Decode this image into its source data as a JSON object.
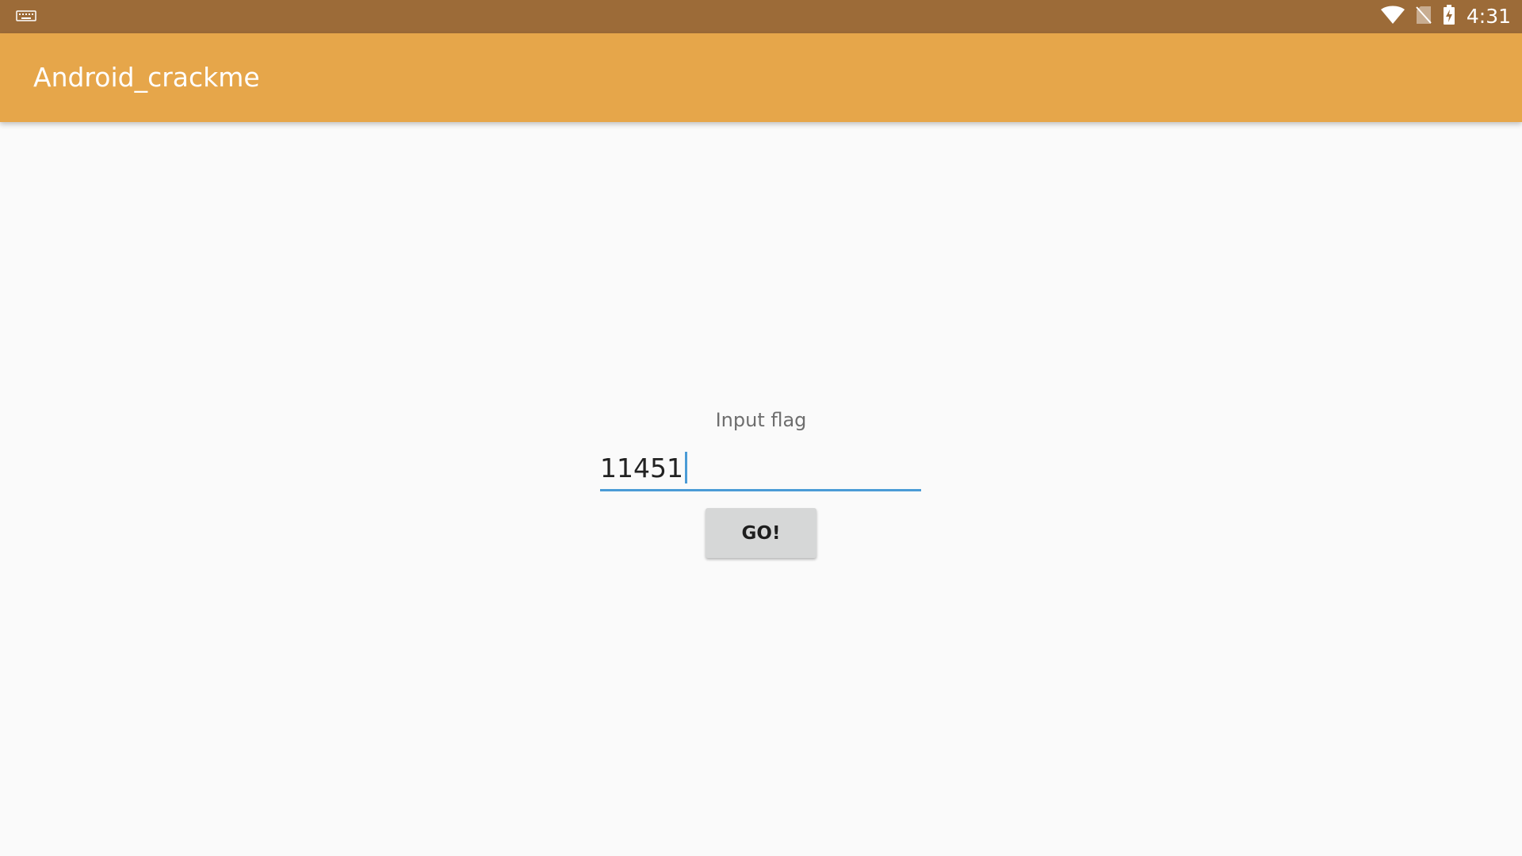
{
  "status_bar": {
    "time": "4:31",
    "icons": [
      "keyboard-icon",
      "wifi-icon",
      "no-sim-icon",
      "battery-charging-icon"
    ],
    "color": "#9c6b38"
  },
  "app_bar": {
    "title": "Android_crackme",
    "color": "#e6a64a"
  },
  "form": {
    "label": "Input flag",
    "input_value": "11451",
    "accent_color": "#4a9bd6",
    "button_label": "GO!"
  }
}
